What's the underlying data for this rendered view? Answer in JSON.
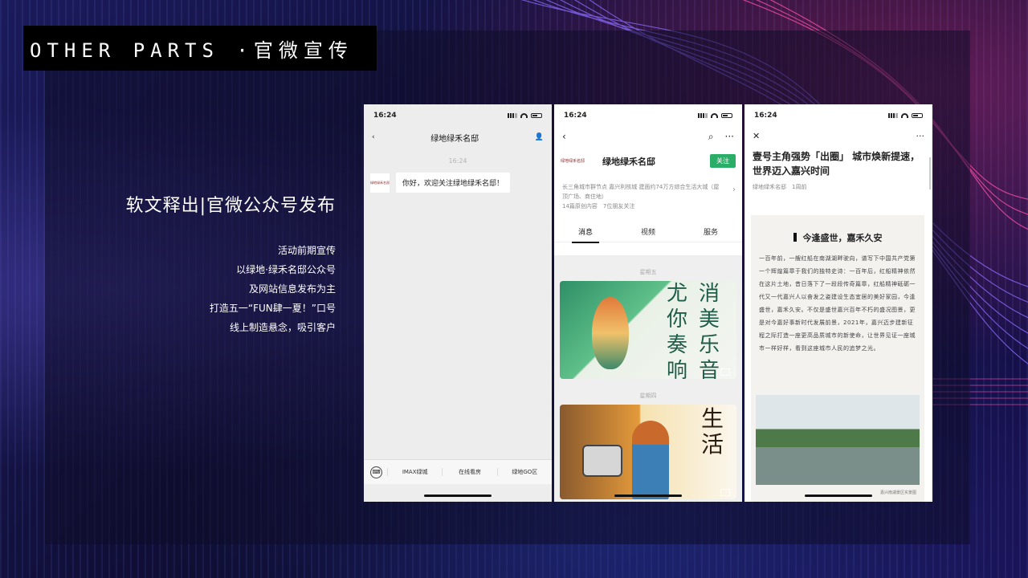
{
  "slide": {
    "title": "OTHER PARTS ·官微宣传",
    "subtitle": "软文释出|官微公众号发布",
    "description": [
      "活动前期宣传",
      "以绿地·绿禾名邸公众号",
      "及网站信息发布为主",
      "打造五一“FUN肆一夏！”口号",
      "线上制造悬念，吸引客户"
    ]
  },
  "phone1": {
    "time": "16:24",
    "title": "绿地绿禾名邸",
    "message_time": "16:24",
    "avatar_text": "绿地绿禾名邸",
    "message": "你好，欢迎关注绿地绿禾名邸！",
    "menu": [
      "IMAX绿城",
      "在线看房",
      "绿地GO区"
    ]
  },
  "phone2": {
    "time": "16:24",
    "account_logo": "绿地绿禾名邸",
    "account_name": "绿地绿禾名邸",
    "follow_label": "关注",
    "intro": "长三角城市群节点 嘉兴利核城 建面约74万方综合生活大城（屋顶广场、商住地）",
    "stats": "14篇原创内容　7位朋友关注",
    "tabs": [
      "消息",
      "视频",
      "服务"
    ],
    "dates": [
      "星期五",
      "星期四"
    ],
    "card1_text": [
      "尤",
      "消",
      "你",
      "美",
      "奏",
      "乐",
      "响",
      "音"
    ],
    "card2_text": [
      "生",
      "活"
    ]
  },
  "phone3": {
    "time": "16:24",
    "title": "壹号主角强势「出圈」 城市焕新提速，世界迈入嘉兴时间",
    "meta": "绿地绿禾名邸　1周前",
    "heading": "今逢盛世，嘉禾久安",
    "body": "一百年前，一艘红船在南湖湖畔驶向，谱写下中国共产党第一个辉煌篇章于我们的独特史诗：一百年后，红船精神依然在这片土地，昔日落下了一段段传奇篇章，红船精神砥砺一代又一代嘉兴人以奋发之姿建设生态宜居的美好家园，今逢盛世，嘉禾久安。不仅是盛世嘉兴百年不朽的盛况图景，更是对今嘉好事新时代发展前景，2021年，嘉兴迈步建新征程之际打造一座更高品质城市的新使命，让世界见证一座城市一样好样，看到这座城市人民的追梦之光。",
    "caption": "嘉兴南湖景区实景图"
  }
}
